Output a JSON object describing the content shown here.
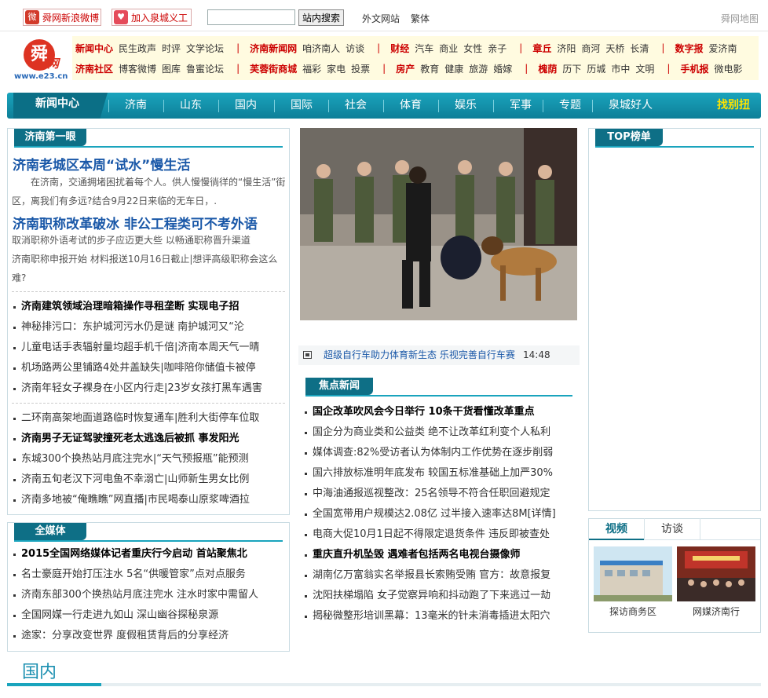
{
  "topbar": {
    "weibo_label": "舜网新浪微博",
    "join_label": "加入泉城义工",
    "search_placeholder": "",
    "search_button": "站内搜索",
    "foreign_link": "外文网站",
    "traditional_link": "繁体",
    "sitemap": "舜网地图"
  },
  "logo": {
    "glyph": "舜",
    "net": "网",
    "url": "www.e23.cn"
  },
  "channels": {
    "row1": [
      {
        "head": "新闻中心",
        "items": [
          "民生政声",
          "时评",
          "文学论坛"
        ]
      },
      {
        "head": "济南新闻网",
        "items": [
          "咱济南人",
          "访谈"
        ]
      },
      {
        "head": "财经",
        "items": [
          "汽车",
          "商业",
          "女性",
          "亲子"
        ]
      },
      {
        "head": "章丘",
        "items": [
          "济阳",
          "商河",
          "天桥",
          "长清"
        ]
      },
      {
        "head": "数字报",
        "items": [
          "爱济南"
        ]
      }
    ],
    "row2": [
      {
        "head": "济南社区",
        "items": [
          "博客微博",
          "图库",
          "鲁蜜论坛"
        ]
      },
      {
        "head": "芙蓉街商城",
        "items": [
          "福彩",
          "家电",
          "投票"
        ]
      },
      {
        "head": "房产",
        "items": [
          "教育",
          "健康",
          "旅游",
          "婚嫁"
        ]
      },
      {
        "head": "槐荫",
        "items": [
          "历下",
          "历城",
          "市中",
          "文明"
        ]
      },
      {
        "head": "手机报",
        "items": [
          "微电影"
        ]
      }
    ]
  },
  "nav": {
    "home": "新闻中心",
    "items": [
      "济南",
      "山东",
      "国内",
      "国际",
      "社会",
      "体育",
      "娱乐",
      "军事",
      "专题",
      "泉城好人"
    ],
    "find": "找别扭"
  },
  "jinan": {
    "tab": "济南第一眼",
    "headline1": "济南老城区本周“试水”慢生活",
    "summary1": "　　在济南，交通拥堵困扰着每个人。供人慢慢徜徉的“慢生活”街区，离我们有多远?结合9月22日来临的无车日，.",
    "headline2": "济南职称改革破冰  非公工程类可不考外语",
    "summary2a": "取消职称外语考试的步子应迈更大些  以畅通职称晋升渠道",
    "summary2b": "济南职称申报开始  材料报送10月16日截止|想评高级职称会这么难?",
    "list1": [
      "济南建筑领域治理暗箱操作寻租垄断  实现电子招",
      "神秘排污口：东护城河污水仍是谜  南护城河又“沦",
      "儿童电话手表辐射量均超手机千倍|济南本周天气一晴",
      "机场路两公里铺路4处井盖缺失|咖啡陪你储值卡被停",
      "济南年轻女子裸身在小区内行走|23岁女孩打黑车遇害"
    ],
    "list2": [
      "二环南高架地面道路临时恢复通车|胜利大街停车位取",
      "济南男子无证驾驶撞死老太逃逸后被抓  事发阳光",
      "东城300个换热站月底注完水|“天气预报瓶”能预测",
      "济南五旬老汉下河电鱼不幸溺亡|山师新生男女比例",
      "济南多地被“俺瞧瞧”网直播|市民喝泰山原浆啤酒拉"
    ]
  },
  "media": {
    "tab": "全媒体",
    "list": [
      "2015全国网络媒体记者重庆行今启动  首站聚焦北",
      "名士豪庭开始打压注水  5名“供暖管家”点对点服务",
      "济南东部300个换热站月底注完水  注水时家中需留人",
      "全国网媒一行走进九如山  深山幽谷探秘泉源",
      "途家：分享改变世界  度假租赁背后的分享经济"
    ]
  },
  "photo_caption": {
    "text": "超级自行车助力体育新生态  乐视完善自行车赛",
    "time": "14:48"
  },
  "focus": {
    "tab": "焦点新闻",
    "list": [
      "国企改革吹风会今日举行  10条干货看懂改革重点",
      "国企分为商业类和公益类  绝不让改革红利变个人私利",
      "媒体调查:82%受访者认为体制内工作优势在逐步削弱",
      "国六排放标准明年底发布  较国五标准基础上加严30%",
      "中海油通报巡视整改：25名领导不符合任职回避规定",
      "全国宽带用户规模达2.08亿  过半接入速率达8M[详情]",
      "电商大促10月1日起不得限定退货条件  违反即被查处",
      "重庆直升机坠毁  遇难者包括两名电视台摄像师",
      "湖南亿万富翁实名举报县长索贿受贿  官方：故意报复",
      "沈阳扶梯塌陷  女子觉察异响和抖动跑了下来逃过一劫",
      "揭秘微整形培训黑幕：13毫米的针未消毒插进太阳穴"
    ]
  },
  "top": {
    "tab": "TOP榜单"
  },
  "video": {
    "tab_video": "视频",
    "tab_interview": "访谈",
    "thumbs": [
      "探访商务区",
      "网媒济南行"
    ]
  },
  "section": {
    "title": "国内"
  },
  "colors": {
    "accent": "#1aa4bd",
    "nav_dark": "#0e6f86",
    "headline": "#1a58a8",
    "red": "#cc0000"
  }
}
